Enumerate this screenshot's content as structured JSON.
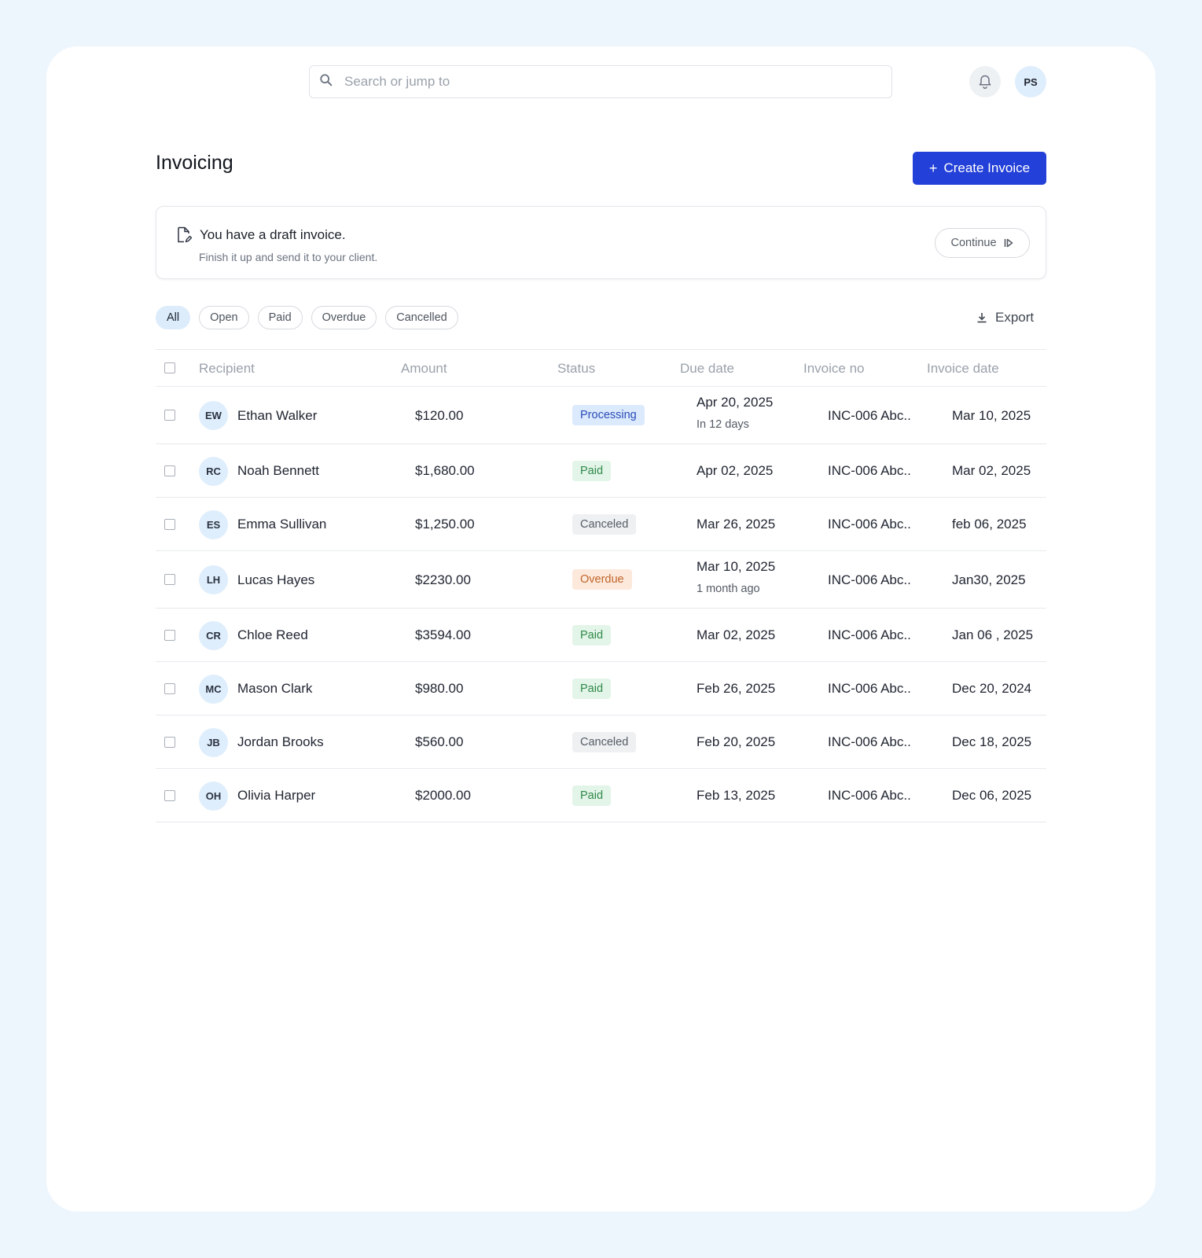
{
  "header": {
    "search_placeholder": "Search or jump to",
    "user_initials": "PS"
  },
  "page": {
    "title": "Invoicing",
    "create_label": "Create Invoice",
    "create_icon": "+"
  },
  "draft": {
    "title": "You have a draft invoice.",
    "subtitle": "Finish it up and send it to your client.",
    "continue_label": "Continue"
  },
  "filters": [
    "All",
    "Open",
    "Paid",
    "Overdue",
    "Cancelled"
  ],
  "active_filter": "All",
  "export_label": "Export",
  "columns": {
    "recipient": "Recipient",
    "amount": "Amount",
    "status": "Status",
    "due_date": "Due date",
    "invoice_no": "Invoice no",
    "invoice_date": "Invoice date"
  },
  "rows": [
    {
      "initials": "EW",
      "name": "Ethan Walker",
      "amount": "$120.00",
      "status": "Processing",
      "status_type": "processing",
      "due": "Apr 20, 2025",
      "due_sub": "In 12 days",
      "invoice_no": "INC-006 Abc..",
      "invoice_date": "Mar 10, 2025"
    },
    {
      "initials": "RC",
      "name": "Noah Bennett",
      "amount": "$1,680.00",
      "status": "Paid",
      "status_type": "paid",
      "due": "Apr 02, 2025",
      "due_sub": "",
      "invoice_no": "INC-006 Abc..",
      "invoice_date": "Mar 02, 2025"
    },
    {
      "initials": "ES",
      "name": "Emma Sullivan",
      "amount": "$1,250.00",
      "status": "Canceled",
      "status_type": "canceled",
      "due": "Mar 26, 2025",
      "due_sub": "",
      "invoice_no": "INC-006 Abc..",
      "invoice_date": "feb 06, 2025"
    },
    {
      "initials": "LH",
      "name": "Lucas Hayes",
      "amount": "$2230.00",
      "status": "Overdue",
      "status_type": "overdue",
      "due": "Mar 10, 2025",
      "due_sub": "1 month ago",
      "invoice_no": "INC-006 Abc..",
      "invoice_date": "Jan30, 2025"
    },
    {
      "initials": "CR",
      "name": "Chloe Reed",
      "amount": "$3594.00",
      "status": "Paid",
      "status_type": "paid",
      "due": "Mar 02, 2025",
      "due_sub": "",
      "invoice_no": "INC-006 Abc..",
      "invoice_date": "Jan 06 , 2025"
    },
    {
      "initials": "MC",
      "name": "Mason Clark",
      "amount": "$980.00",
      "status": "Paid",
      "status_type": "paid",
      "due": "Feb 26, 2025",
      "due_sub": "",
      "invoice_no": "INC-006 Abc..",
      "invoice_date": "Dec 20, 2024"
    },
    {
      "initials": "JB",
      "name": "Jordan Brooks",
      "amount": "$560.00",
      "status": "Canceled",
      "status_type": "canceled",
      "due": "Feb 20, 2025",
      "due_sub": "",
      "invoice_no": "INC-006 Abc..",
      "invoice_date": "Dec 18, 2025"
    },
    {
      "initials": "OH",
      "name": "Olivia Harper",
      "amount": "$2000.00",
      "status": "Paid",
      "status_type": "paid",
      "due": "Feb 13, 2025",
      "due_sub": "",
      "invoice_no": "INC-006 Abc..",
      "invoice_date": "Dec 06, 2025"
    }
  ],
  "colors": {
    "primary": "#2340d8",
    "background": "#eef6fd",
    "processing": "#2a4bb8",
    "paid": "#2f8a4a",
    "overdue": "#c0652a",
    "canceled": "#555c66"
  }
}
